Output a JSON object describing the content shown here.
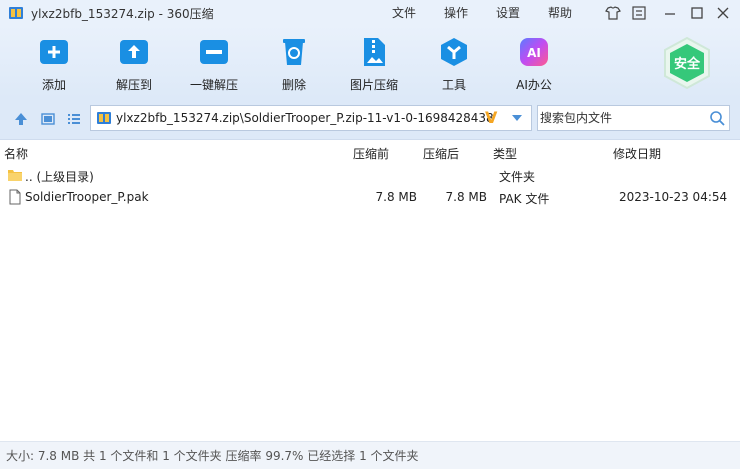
{
  "window": {
    "title": "ylxz2bfb_153274.zip - 360压缩",
    "menu": [
      "文件",
      "操作",
      "设置",
      "帮助"
    ]
  },
  "toolbar": {
    "items": [
      {
        "label": "添加",
        "icon": "add-icon"
      },
      {
        "label": "解压到",
        "icon": "extract-to-icon"
      },
      {
        "label": "一键解压",
        "icon": "one-click-extract-icon"
      },
      {
        "label": "删除",
        "icon": "delete-icon"
      },
      {
        "label": "图片压缩",
        "icon": "image-compress-icon"
      },
      {
        "label": "工具",
        "icon": "tools-icon"
      },
      {
        "label": "AI办公",
        "icon": "ai-office-icon"
      }
    ],
    "safe_badge": "安全",
    "ai_glyph": "AI"
  },
  "address": {
    "path": "ylxz2bfb_153274.zip\\SoldierTrooper_P.zip-11-v1-0-1698428438",
    "v_mark": "V",
    "search_placeholder": "搜索包内文件"
  },
  "columns": {
    "name": "名称",
    "packed": "压缩前",
    "compressed": "压缩后",
    "type": "类型",
    "modified": "修改日期"
  },
  "files": [
    {
      "name": ".. (上级目录)",
      "packed": "",
      "compressed": "",
      "type": "文件夹",
      "modified": "",
      "icon": "folder-icon"
    },
    {
      "name": "SoldierTrooper_P.pak",
      "packed": "7.8 MB",
      "compressed": "7.8 MB",
      "type": "PAK 文件",
      "modified": "2023-10-23 04:54",
      "icon": "file-icon"
    }
  ],
  "status": {
    "text": "大小: 7.8 MB 共 1 个文件和 1 个文件夹 压缩率 99.7% 已经选择 1 个文件夹"
  },
  "colors": {
    "accent_blue": "#1a8fe3",
    "safe_green": "#35c87a",
    "v_orange": "#f5a623"
  }
}
